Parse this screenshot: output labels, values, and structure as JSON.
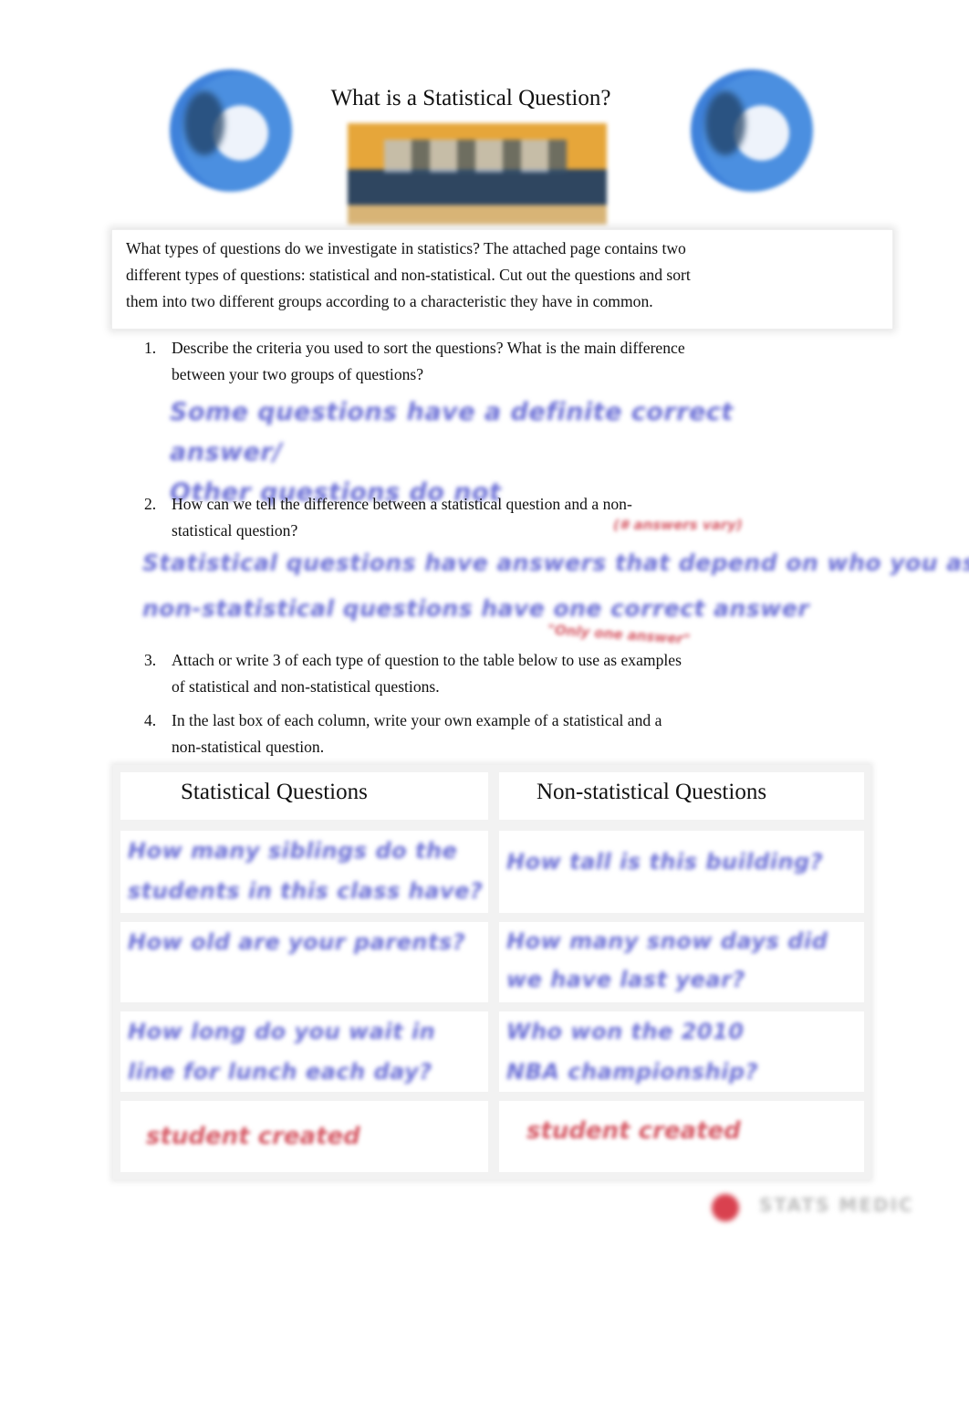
{
  "header": {
    "title": "What is a Statistical Question?",
    "left_logo": "chat-bubble-logo-icon",
    "right_logo": "chat-bubble-logo-icon",
    "banner": "people-with-question-bubbles-image"
  },
  "intro": {
    "lines": [
      "What types of questions do we investigate in statistics? The attached page contains two",
      "different types of questions: statistical and non-statistical. Cut out the questions and sort",
      "them into two different groups according to a characteristic they have in common."
    ]
  },
  "questions": [
    {
      "number": "1.",
      "lines": [
        "Describe the criteria you used to sort the questions? What is the main difference",
        "between your two groups of questions?"
      ],
      "answer_lines": [
        "Some questions have a definite correct answer/",
        "Other questions do not"
      ]
    },
    {
      "number": "2.",
      "lines": [
        "How can we tell the difference between a statistical question and a non-",
        "statistical question?"
      ],
      "answer_lines": [
        "Statistical questions have answers that depend on who you ask",
        "non-statistical questions have one correct answer"
      ],
      "annotations": [
        "(# answers vary)",
        "\"Only one answer\""
      ]
    },
    {
      "number": "3.",
      "lines": [
        "Attach or write 3 of each type of question to the table below to use as examples",
        "of statistical and non-statistical questions."
      ]
    },
    {
      "number": "4.",
      "lines": [
        "In the last box of each column, write your own example of a statistical and a",
        "non-statistical question."
      ]
    }
  ],
  "table": {
    "headers": [
      "Statistical Questions",
      "Non-statistical Questions"
    ],
    "rows": [
      [
        [
          "How many siblings do the",
          "students in this class have?"
        ],
        [
          "How tall is this building?"
        ]
      ],
      [
        [
          "How old are your parents?"
        ],
        [
          "How many snow days did",
          "we have last year?"
        ]
      ],
      [
        [
          "How long do you wait in",
          "line for lunch each day?"
        ],
        [
          "Who won the 2010",
          "NBA championship?"
        ]
      ],
      [
        [
          "student created"
        ],
        [
          "student created"
        ]
      ]
    ]
  },
  "footer": {
    "brand": "STATS MEDIC",
    "brand_color": "#d9414f"
  }
}
